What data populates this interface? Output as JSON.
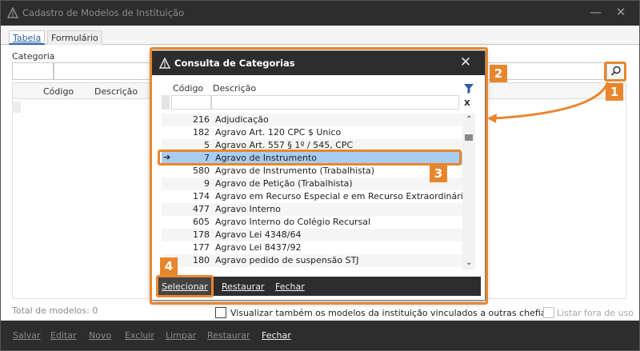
{
  "window": {
    "title": "Cadastro de Modelos de Instituição",
    "minimize": "—",
    "close": "✕"
  },
  "tabs": [
    {
      "label": "Tabela"
    },
    {
      "label": "Formulário"
    }
  ],
  "filters": {
    "categoria_label": "Categoria"
  },
  "grid": {
    "columns": [
      "Código",
      "Descrição"
    ]
  },
  "status": {
    "total": "Total de modelos: 0"
  },
  "options": {
    "show_linked": "Visualizar também os modelos da instituição vinculados a outras chefias",
    "list_outside_use": "Listar fora de uso"
  },
  "toolbar": {
    "salvar": "Salvar",
    "editar": "Editar",
    "novo": "Novo",
    "excluir": "Excluir",
    "limpar": "Limpar",
    "restaurar": "Restaurar",
    "fechar": "Fechar"
  },
  "dialog": {
    "title": "Consulta de Categorias",
    "close": "✕",
    "columns": [
      "Código",
      "Descrição"
    ],
    "clear_filter": "x",
    "selected_marker": "➔",
    "rows": [
      {
        "code": "216",
        "desc": "Adjudicação"
      },
      {
        "code": "182",
        "desc": "Agravo Art. 120 CPC $ Unico"
      },
      {
        "code": "5",
        "desc": "Agravo Art. 557 § 1º / 545, CPC"
      },
      {
        "code": "7",
        "desc": "Agravo de Instrumento"
      },
      {
        "code": "580",
        "desc": "Agravo de Instrumento (Trabalhista)"
      },
      {
        "code": "9",
        "desc": "Agravo de Petição (Trabalhista)"
      },
      {
        "code": "174",
        "desc": "Agravo em Recurso Especial e em Recurso Extraordinário"
      },
      {
        "code": "477",
        "desc": "Agravo Interno"
      },
      {
        "code": "605",
        "desc": "Agravo Interno do Colégio Recursal"
      },
      {
        "code": "178",
        "desc": "Agravo Lei 4348/64"
      },
      {
        "code": "177",
        "desc": "Agravo Lei 8437/92"
      },
      {
        "code": "180",
        "desc": "Agravo pedido de suspensão STJ"
      }
    ],
    "buttons": {
      "selecionar": "Selecionar",
      "restaurar": "Restaurar",
      "fechar": "Fechar"
    }
  },
  "callouts": [
    "1",
    "2",
    "3",
    "4"
  ],
  "colors": {
    "accent": "#e8862e",
    "titlebar": "#2d2d2d",
    "selection": "#a9cdf0",
    "tab_active": "#2a5fa8"
  }
}
